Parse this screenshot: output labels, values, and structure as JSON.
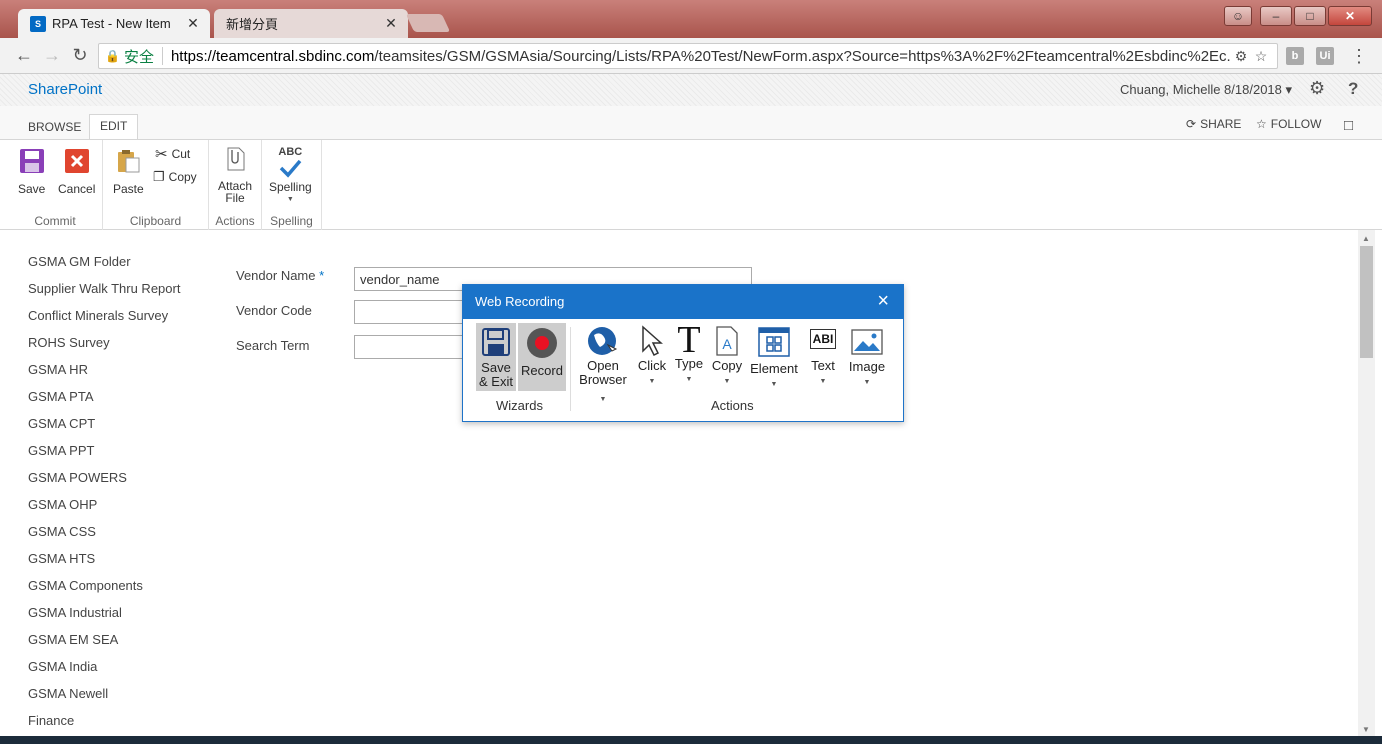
{
  "browser": {
    "tabs": [
      {
        "title": "RPA Test - New Item",
        "favicon": "S"
      },
      {
        "title": "新增分頁"
      }
    ],
    "secure_label": "安全",
    "url_domain": "https://teamcentral.sbdinc.com",
    "url_path": "/teamsites/GSM/GSMAsia/Sourcing/Lists/RPA%20Test/NewForm.aspx?Source=https%3A%2F%2Fteamcentral%2Esbdinc%2Ec...",
    "extensions": [
      "b",
      "Ui"
    ]
  },
  "suite": {
    "brand": "SharePoint",
    "user": "Chuang, Michelle 8/18/2018",
    "user_caret": "▾"
  },
  "ribbon": {
    "tabs": [
      "BROWSE",
      "EDIT"
    ],
    "share": "SHARE",
    "follow": "FOLLOW",
    "groups": {
      "commit": {
        "label": "Commit",
        "save": "Save",
        "cancel": "Cancel"
      },
      "clipboard": {
        "label": "Clipboard",
        "paste": "Paste",
        "cut": "Cut",
        "copy": "Copy"
      },
      "actions": {
        "label": "Actions",
        "attach_1": "Attach",
        "attach_2": "File"
      },
      "spelling": {
        "label": "Spelling",
        "spelling": "Spelling",
        "abc": "ABC"
      }
    }
  },
  "leftnav": [
    "GSMA GM Folder",
    "Supplier Walk Thru Report",
    "Conflict Minerals Survey",
    "ROHS Survey",
    "GSMA HR",
    "GSMA PTA",
    "GSMA CPT",
    "GSMA PPT",
    "GSMA POWERS",
    "GSMA OHP",
    "GSMA CSS",
    "GSMA HTS",
    "GSMA Components",
    "GSMA Industrial",
    "GSMA EM SEA",
    "GSMA India",
    "GSMA Newell",
    "Finance"
  ],
  "form": {
    "vendor_name_label": "Vendor Name",
    "required_mark": "*",
    "vendor_name_value": "vendor_name",
    "vendor_code_label": "Vendor Code",
    "search_term_label": "Search Term"
  },
  "web_recording": {
    "title": "Web Recording",
    "save_exit_1": "Save",
    "save_exit_2": "& Exit",
    "record": "Record",
    "open_1": "Open",
    "open_2": "Browser",
    "click": "Click",
    "type": "Type",
    "copy": "Copy",
    "element": "Element",
    "text": "Text",
    "image": "Image",
    "wizards_label": "Wizards",
    "actions_label": "Actions",
    "text_icon_glyph": "ABI"
  },
  "colors": {
    "accent": "#0072c6",
    "titlebar": "#1a73c9",
    "tabbar": "#b8635b",
    "record_red": "#e81123"
  }
}
